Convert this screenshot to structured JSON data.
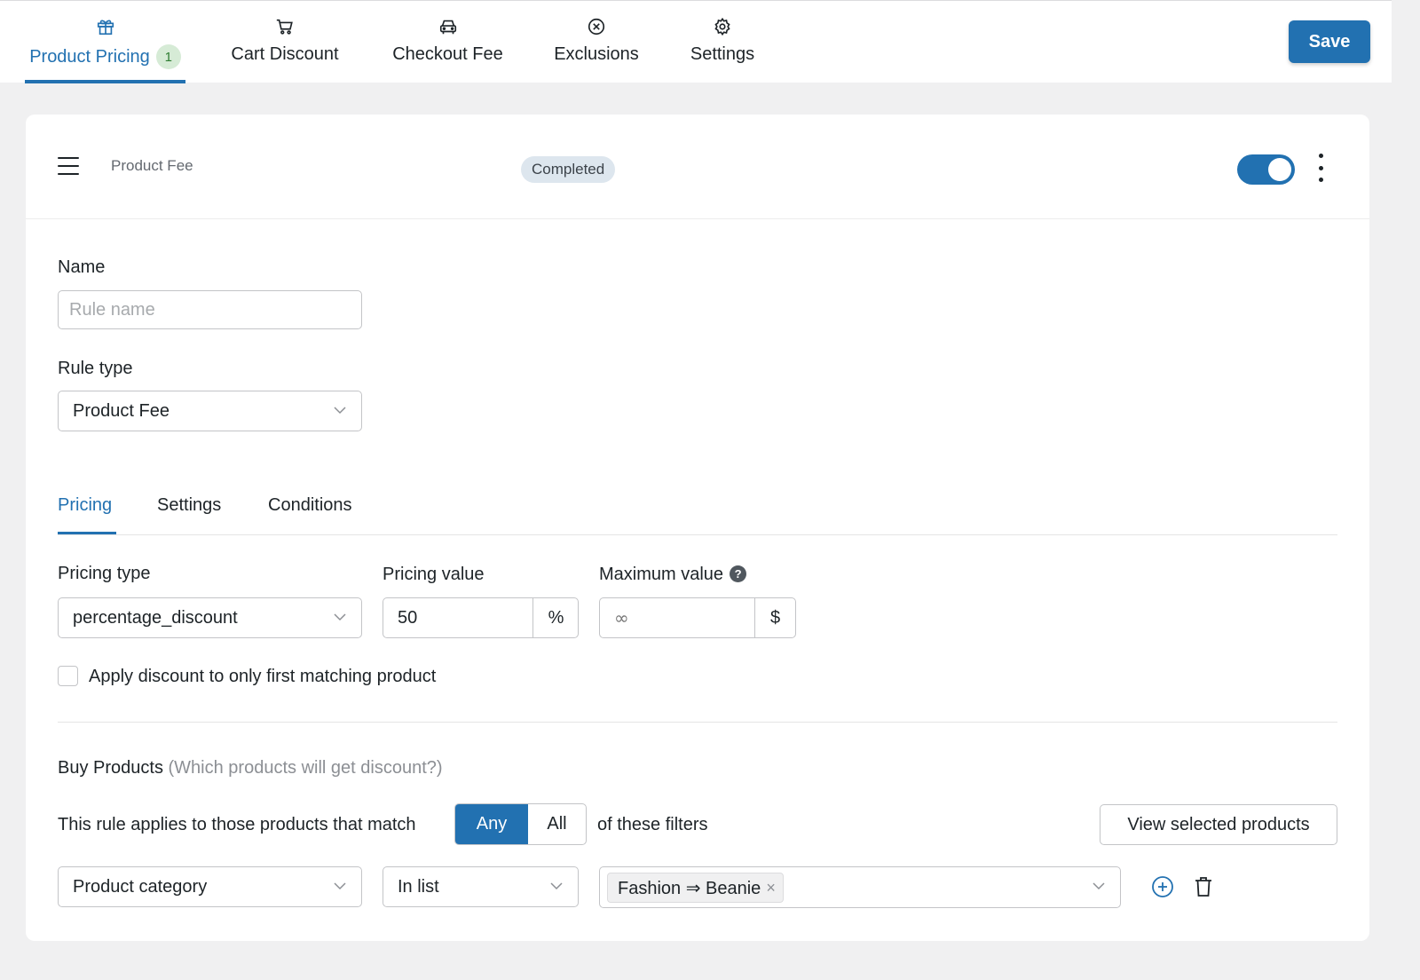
{
  "nav": {
    "tabs": [
      {
        "label": "Product Pricing",
        "icon": "gift-icon",
        "badge": "1",
        "active": true
      },
      {
        "label": "Cart Discount",
        "icon": "cart-icon"
      },
      {
        "label": "Checkout Fee",
        "icon": "car-icon"
      },
      {
        "label": "Exclusions",
        "icon": "x-circle-icon"
      },
      {
        "label": "Settings",
        "icon": "gear-icon"
      }
    ],
    "save_label": "Save"
  },
  "rule": {
    "title": "Product Fee",
    "status": "Completed",
    "enabled": true
  },
  "form": {
    "name_label": "Name",
    "name_placeholder": "Rule name",
    "name_value": "",
    "rule_type_label": "Rule type",
    "rule_type_value": "Product Fee"
  },
  "subtabs": [
    "Pricing",
    "Settings",
    "Conditions"
  ],
  "pricing": {
    "type_label": "Pricing type",
    "type_value": "percentage_discount",
    "value_label": "Pricing value",
    "value": "50",
    "value_unit": "%",
    "max_label": "Maximum value",
    "max_placeholder": "∞",
    "max_unit": "$",
    "help_glyph": "?",
    "first_match_label": "Apply discount to only first matching product",
    "first_match_checked": false
  },
  "buy_products": {
    "heading": "Buy Products",
    "hint": "(Which products will get discount?)",
    "match_prefix": "This rule applies to those products that match",
    "match_options": [
      "Any",
      "All"
    ],
    "match_selected": "Any",
    "match_suffix": "of these filters",
    "view_selected_label": "View selected products",
    "filter": {
      "field": "Product category",
      "operator": "In list",
      "tags": [
        {
          "label": "Fashion ⇒ Beanie",
          "remove": "×"
        }
      ]
    }
  },
  "colors": {
    "accent": "#2271b1",
    "badge_bg": "#d6ebd6",
    "status_bg": "#dde6ee"
  }
}
